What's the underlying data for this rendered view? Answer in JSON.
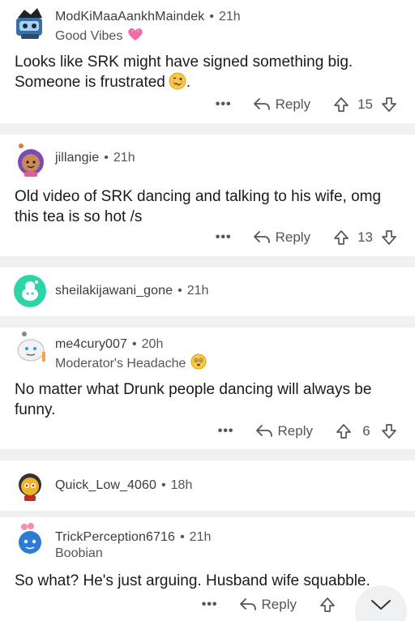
{
  "comments": [
    {
      "username": "ModKiMaaAankhMaindek",
      "time": "21h",
      "flair": "Good Vibes",
      "flair_emoji": "pink-heart-icon",
      "body_lines": [
        "Looks like SRK might have signed something big.",
        "Someone is frustrated"
      ],
      "body_suffix": ".",
      "body_emoji": "woozy-face-icon",
      "more": "•••",
      "reply": "Reply",
      "score": "15"
    },
    {
      "username": "jillangie",
      "time": "21h",
      "body": "Old video of SRK dancing and talking to his wife, omg this tea is so hot /s",
      "more": "•••",
      "reply": "Reply",
      "score": "13"
    },
    {
      "username": "sheilakijawani_gone",
      "time": "21h"
    },
    {
      "username": "me4cury007",
      "time": "20h",
      "flair": "Moderator's Headache",
      "flair_emoji": "flushed-face-icon",
      "body": "No matter what Drunk people dancing will always be funny.",
      "more": "•••",
      "reply": "Reply",
      "score": "6"
    },
    {
      "username": "Quick_Low_4060",
      "time": "18h"
    },
    {
      "username": "TrickPerception6716",
      "time": "21h",
      "flair": "Boobian",
      "body": "So what? He's just arguing. Husband wife squabble.",
      "more": "•••",
      "reply": "Reply"
    }
  ],
  "separator_dot": "•",
  "colors": {
    "separator": "#eef0f2",
    "text": "#1a1a1b",
    "muted": "#555555"
  }
}
